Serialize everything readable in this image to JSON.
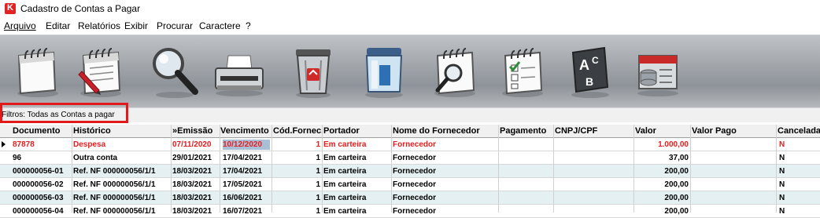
{
  "window": {
    "title": "Cadastro de Contas a Pagar",
    "app_icon_glyph": "K"
  },
  "menu": [
    "Arquivo",
    "Editar",
    "Relatórios",
    "Exibir",
    "Procurar",
    "Caractere",
    "?"
  ],
  "toolbar": [
    {
      "name": "new-notepad-icon"
    },
    {
      "name": "edit-notepad-icon"
    },
    {
      "name": "search-magnifier-icon"
    },
    {
      "name": "printer-icon"
    },
    {
      "name": "recycle-bin-icon"
    },
    {
      "name": "filter-icon"
    },
    {
      "name": "notepad-search-icon"
    },
    {
      "name": "checklist-icon"
    },
    {
      "name": "sort-abc-icon"
    },
    {
      "name": "folder-database-icon"
    }
  ],
  "filter": {
    "label": "Filtros: Todas as Contas a pagar"
  },
  "grid": {
    "columns": [
      "Documento",
      "Histórico",
      "»Emissão",
      "Vencimento",
      "Cód.Fornec.",
      "Portador",
      "Nome do Fornecedor",
      "Pagamento",
      "CNPJ/CPF",
      "Valor",
      "Valor Pago",
      "Cancelada"
    ],
    "rows": [
      [
        "87878",
        "Despesa",
        "07/11/2020",
        "10/12/2020",
        "1",
        "Em carteira",
        "Fornecedor",
        "",
        "",
        "1.000,00",
        "",
        "N"
      ],
      [
        "96",
        "Outra conta",
        "29/01/2021",
        "17/04/2021",
        "1",
        "Em carteira",
        "Fornecedor",
        "",
        "",
        "37,00",
        "",
        "N"
      ],
      [
        "000000056-01",
        "Ref. NF 000000056/1/1",
        "18/03/2021",
        "17/04/2021",
        "1",
        "Em carteira",
        "Fornecedor",
        "",
        "",
        "200,00",
        "",
        "N"
      ],
      [
        "000000056-02",
        "Ref. NF 000000056/1/1",
        "18/03/2021",
        "17/05/2021",
        "1",
        "Em carteira",
        "Fornecedor",
        "",
        "",
        "200,00",
        "",
        "N"
      ],
      [
        "000000056-03",
        "Ref. NF 000000056/1/1",
        "18/03/2021",
        "16/06/2021",
        "1",
        "Em carteira",
        "Fornecedor",
        "",
        "",
        "200,00",
        "",
        "N"
      ],
      [
        "000000056-04",
        "Ref. NF 000000056/1/1",
        "18/03/2021",
        "16/07/2021",
        "1",
        "Em carteira",
        "Fornecedor",
        "",
        "",
        "200,00",
        "",
        "N"
      ]
    ]
  },
  "colors": {
    "overdue_text": "#e81c1c",
    "alt_row": "#e4f0f2",
    "selected_cell": "#a9bfd6",
    "highlight_box": "#e01a1a"
  }
}
